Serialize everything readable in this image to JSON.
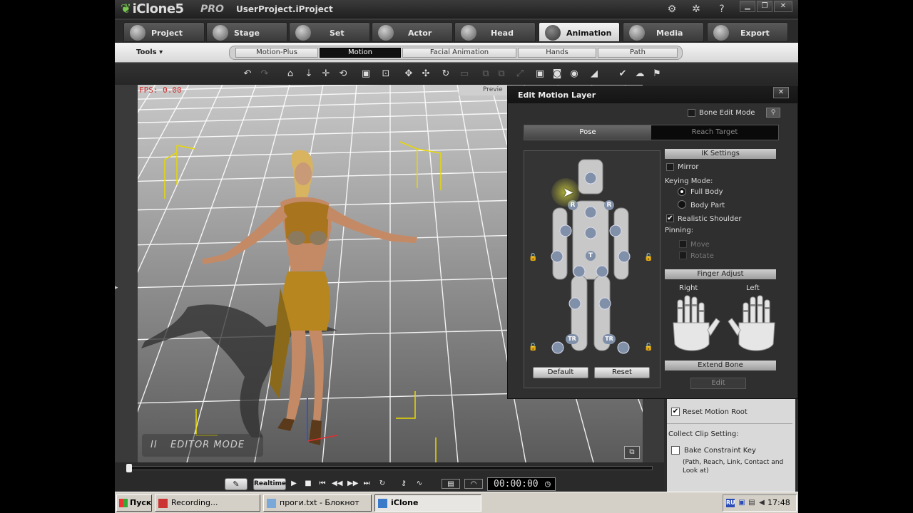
{
  "app": {
    "logo": "iClone5",
    "edition": "PRO",
    "project_title": "UserProject.iProject",
    "title_icons": [
      "tools-icon",
      "settings-icon",
      "help-icon"
    ]
  },
  "main_tabs": [
    {
      "label": "Project",
      "icon": "project-icon"
    },
    {
      "label": "Stage",
      "icon": "stage-icon"
    },
    {
      "label": "Set",
      "icon": "set-icon"
    },
    {
      "label": "Actor",
      "icon": "actor-icon"
    },
    {
      "label": "Head",
      "icon": "head-icon"
    },
    {
      "label": "Animation",
      "icon": "animation-icon",
      "active": true
    },
    {
      "label": "Media",
      "icon": "media-icon"
    },
    {
      "label": "Export",
      "icon": "export-icon"
    }
  ],
  "sub_bar": {
    "tools_label": "Tools ▾",
    "tabs": [
      {
        "label": "Motion-Plus"
      },
      {
        "label": "Motion",
        "active": true
      },
      {
        "label": "Facial Animation"
      },
      {
        "label": "Hands"
      },
      {
        "label": "Path"
      }
    ]
  },
  "viewport": {
    "fps_text": "FPS: 0.00",
    "preview_text": "Previe",
    "editor_mode_text": "EDITOR MODE",
    "pause_symbol": "II"
  },
  "timeline": {
    "realtime_label": "Realtime",
    "timecode": "00:00:00"
  },
  "dialog": {
    "title": "Edit Motion Layer",
    "close_symbol": "✕",
    "bone_edit_mode": "Bone Edit Mode",
    "tabs": {
      "pose": "Pose",
      "reach_target": "Reach Target"
    },
    "joint_labels": {
      "r": "R",
      "t": "T",
      "tr": "TR"
    },
    "default_button": "Default",
    "reset_button": "Reset",
    "ik_settings": "IK Settings",
    "mirror": "Mirror",
    "keying_mode": "Keying Mode:",
    "full_body": "Full Body",
    "body_part": "Body Part",
    "realistic_shoulder": "Realistic Shoulder",
    "pinning": "Pinning:",
    "move": "Move",
    "rotate": "Rotate",
    "finger_adjust": "Finger Adjust",
    "right": "Right",
    "left": "Left",
    "extend_bone": "Extend Bone",
    "edit_button": "Edit",
    "mirror_checked": false,
    "full_body_selected": true,
    "realistic_shoulder_checked": true
  },
  "right_panel": {
    "reset_motion_root": "Reset Motion Root",
    "collect_clip_setting": "Collect Clip Setting:",
    "bake_constraint_key": "Bake Constraint Key",
    "bake_note": "(Path, Reach, Link, Contact and Look at)",
    "reset_motion_root_checked": true,
    "bake_constraint_key_checked": false
  },
  "taskbar": {
    "start_label": "Пуск",
    "tasks": [
      {
        "label": "Recording..."
      },
      {
        "label": "проги.txt - Блокнот"
      },
      {
        "label": "iClone",
        "active": true
      }
    ],
    "lang": "RU",
    "clock": "17:48"
  },
  "colors": {
    "accent_active_tab": "#e6e6e6",
    "fps_red": "#d03030",
    "viewport_grid": "#ffffff",
    "markers_yellow": "#e8d800"
  }
}
